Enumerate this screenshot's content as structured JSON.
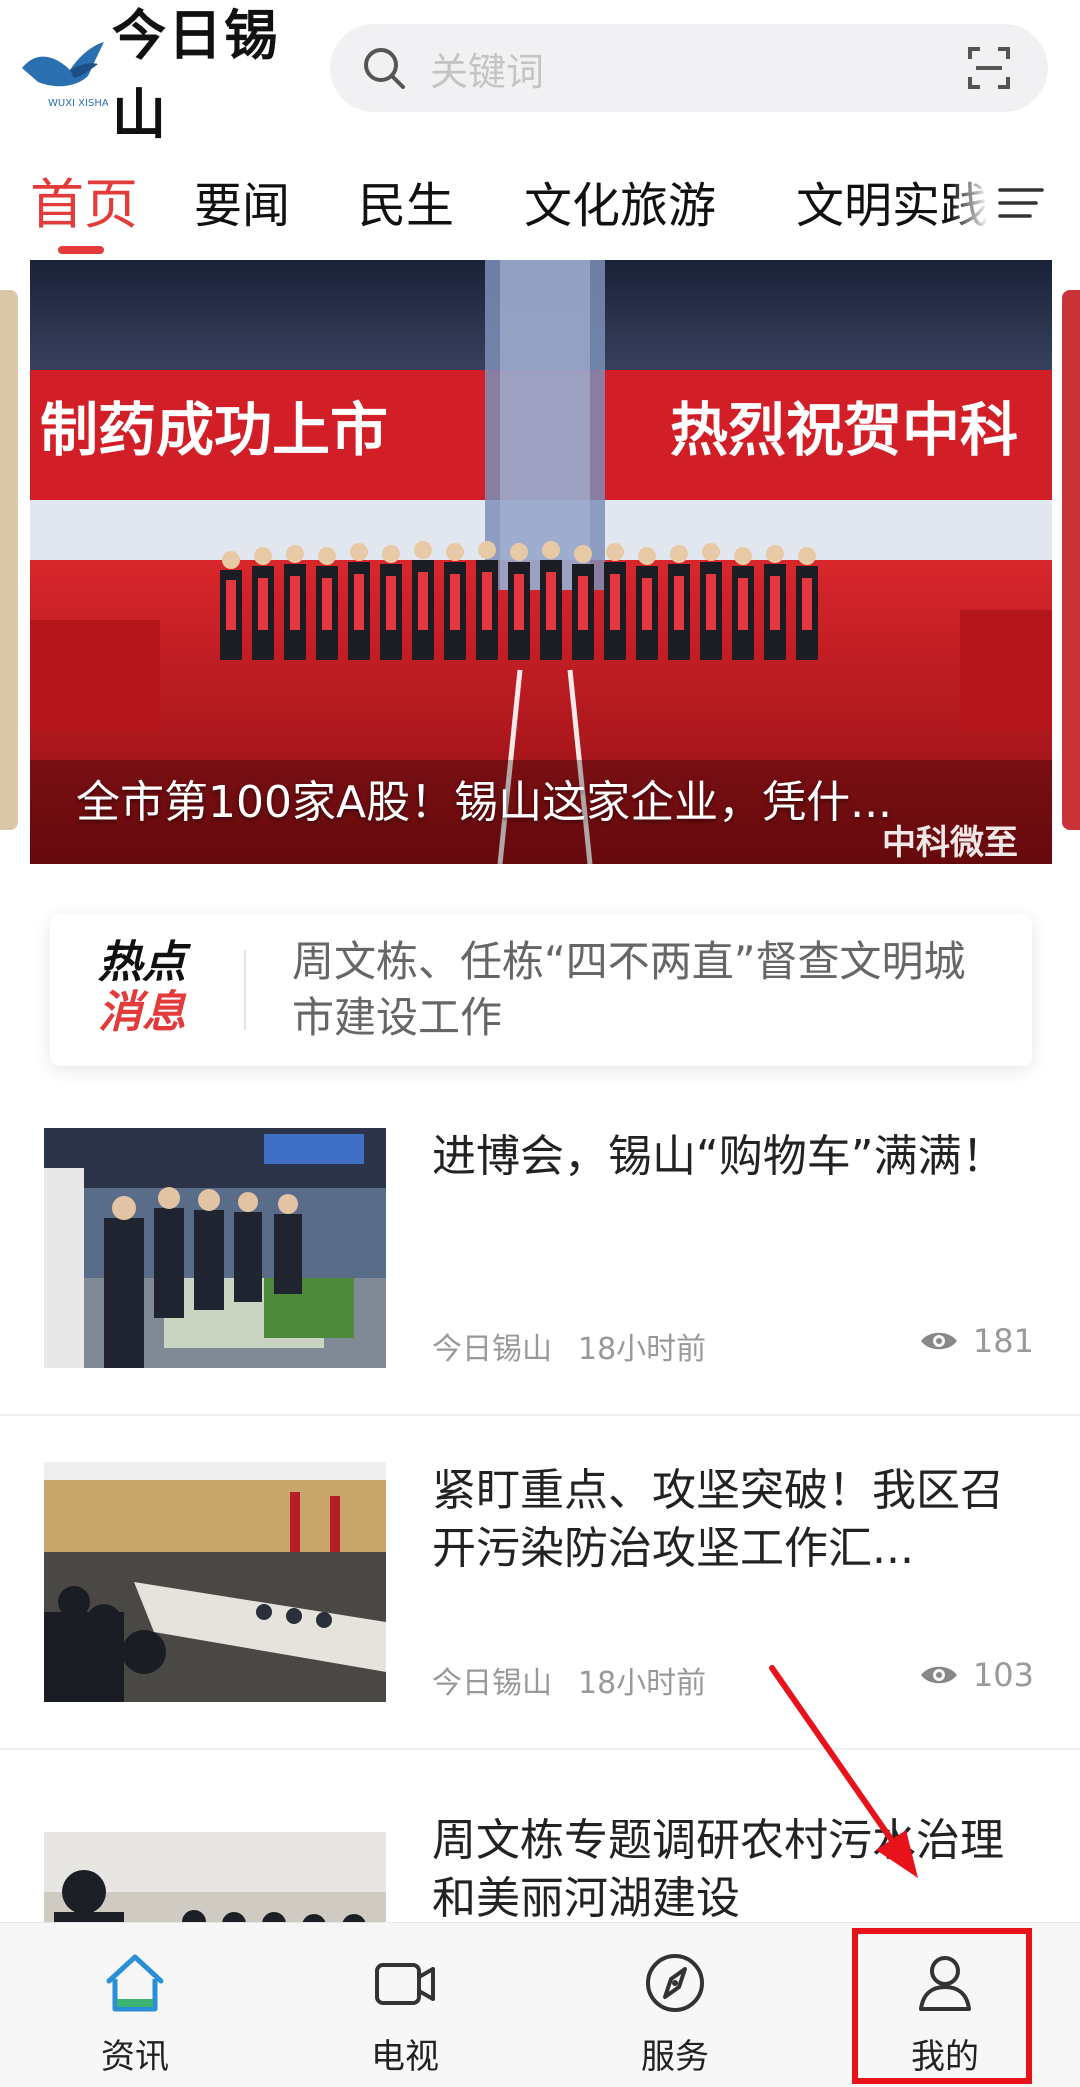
{
  "header": {
    "logo_text": "今日锡山",
    "search_placeholder": "关键词"
  },
  "tabs": [
    {
      "label": "首页",
      "active": true
    },
    {
      "label": "要闻"
    },
    {
      "label": "民生"
    },
    {
      "label": "文化旅游"
    },
    {
      "label": "文明实践"
    }
  ],
  "banner": {
    "caption": "全市第100家A股！锡山这家企业，凭什...",
    "watermark": "中科微至"
  },
  "hot_news": {
    "badge_line1": "热点",
    "badge_line2": "消息",
    "text": "周文栋、任栋“四不两直”督查文明城市建设工作"
  },
  "news_items": [
    {
      "title": "进博会，锡山“购物车”满满！",
      "source": "今日锡山",
      "time": "18小时前",
      "views": "181"
    },
    {
      "title": "紧盯重点、攻坚突破！我区召开污染防治攻坚工作汇...",
      "source": "今日锡山",
      "time": "18小时前",
      "views": "103"
    },
    {
      "title": "周文栋专题调研农村污水治理和美丽河湖建设",
      "source": "",
      "time": "",
      "views": ""
    }
  ],
  "bottom_nav": [
    {
      "label": "资讯",
      "icon": "home-icon",
      "active": true
    },
    {
      "label": "电视",
      "icon": "video-camera-icon"
    },
    {
      "label": "服务",
      "icon": "compass-icon"
    },
    {
      "label": "我的",
      "icon": "user-icon"
    }
  ],
  "colors": {
    "accent": "#e33a3a",
    "annotation": "#e8131a"
  }
}
